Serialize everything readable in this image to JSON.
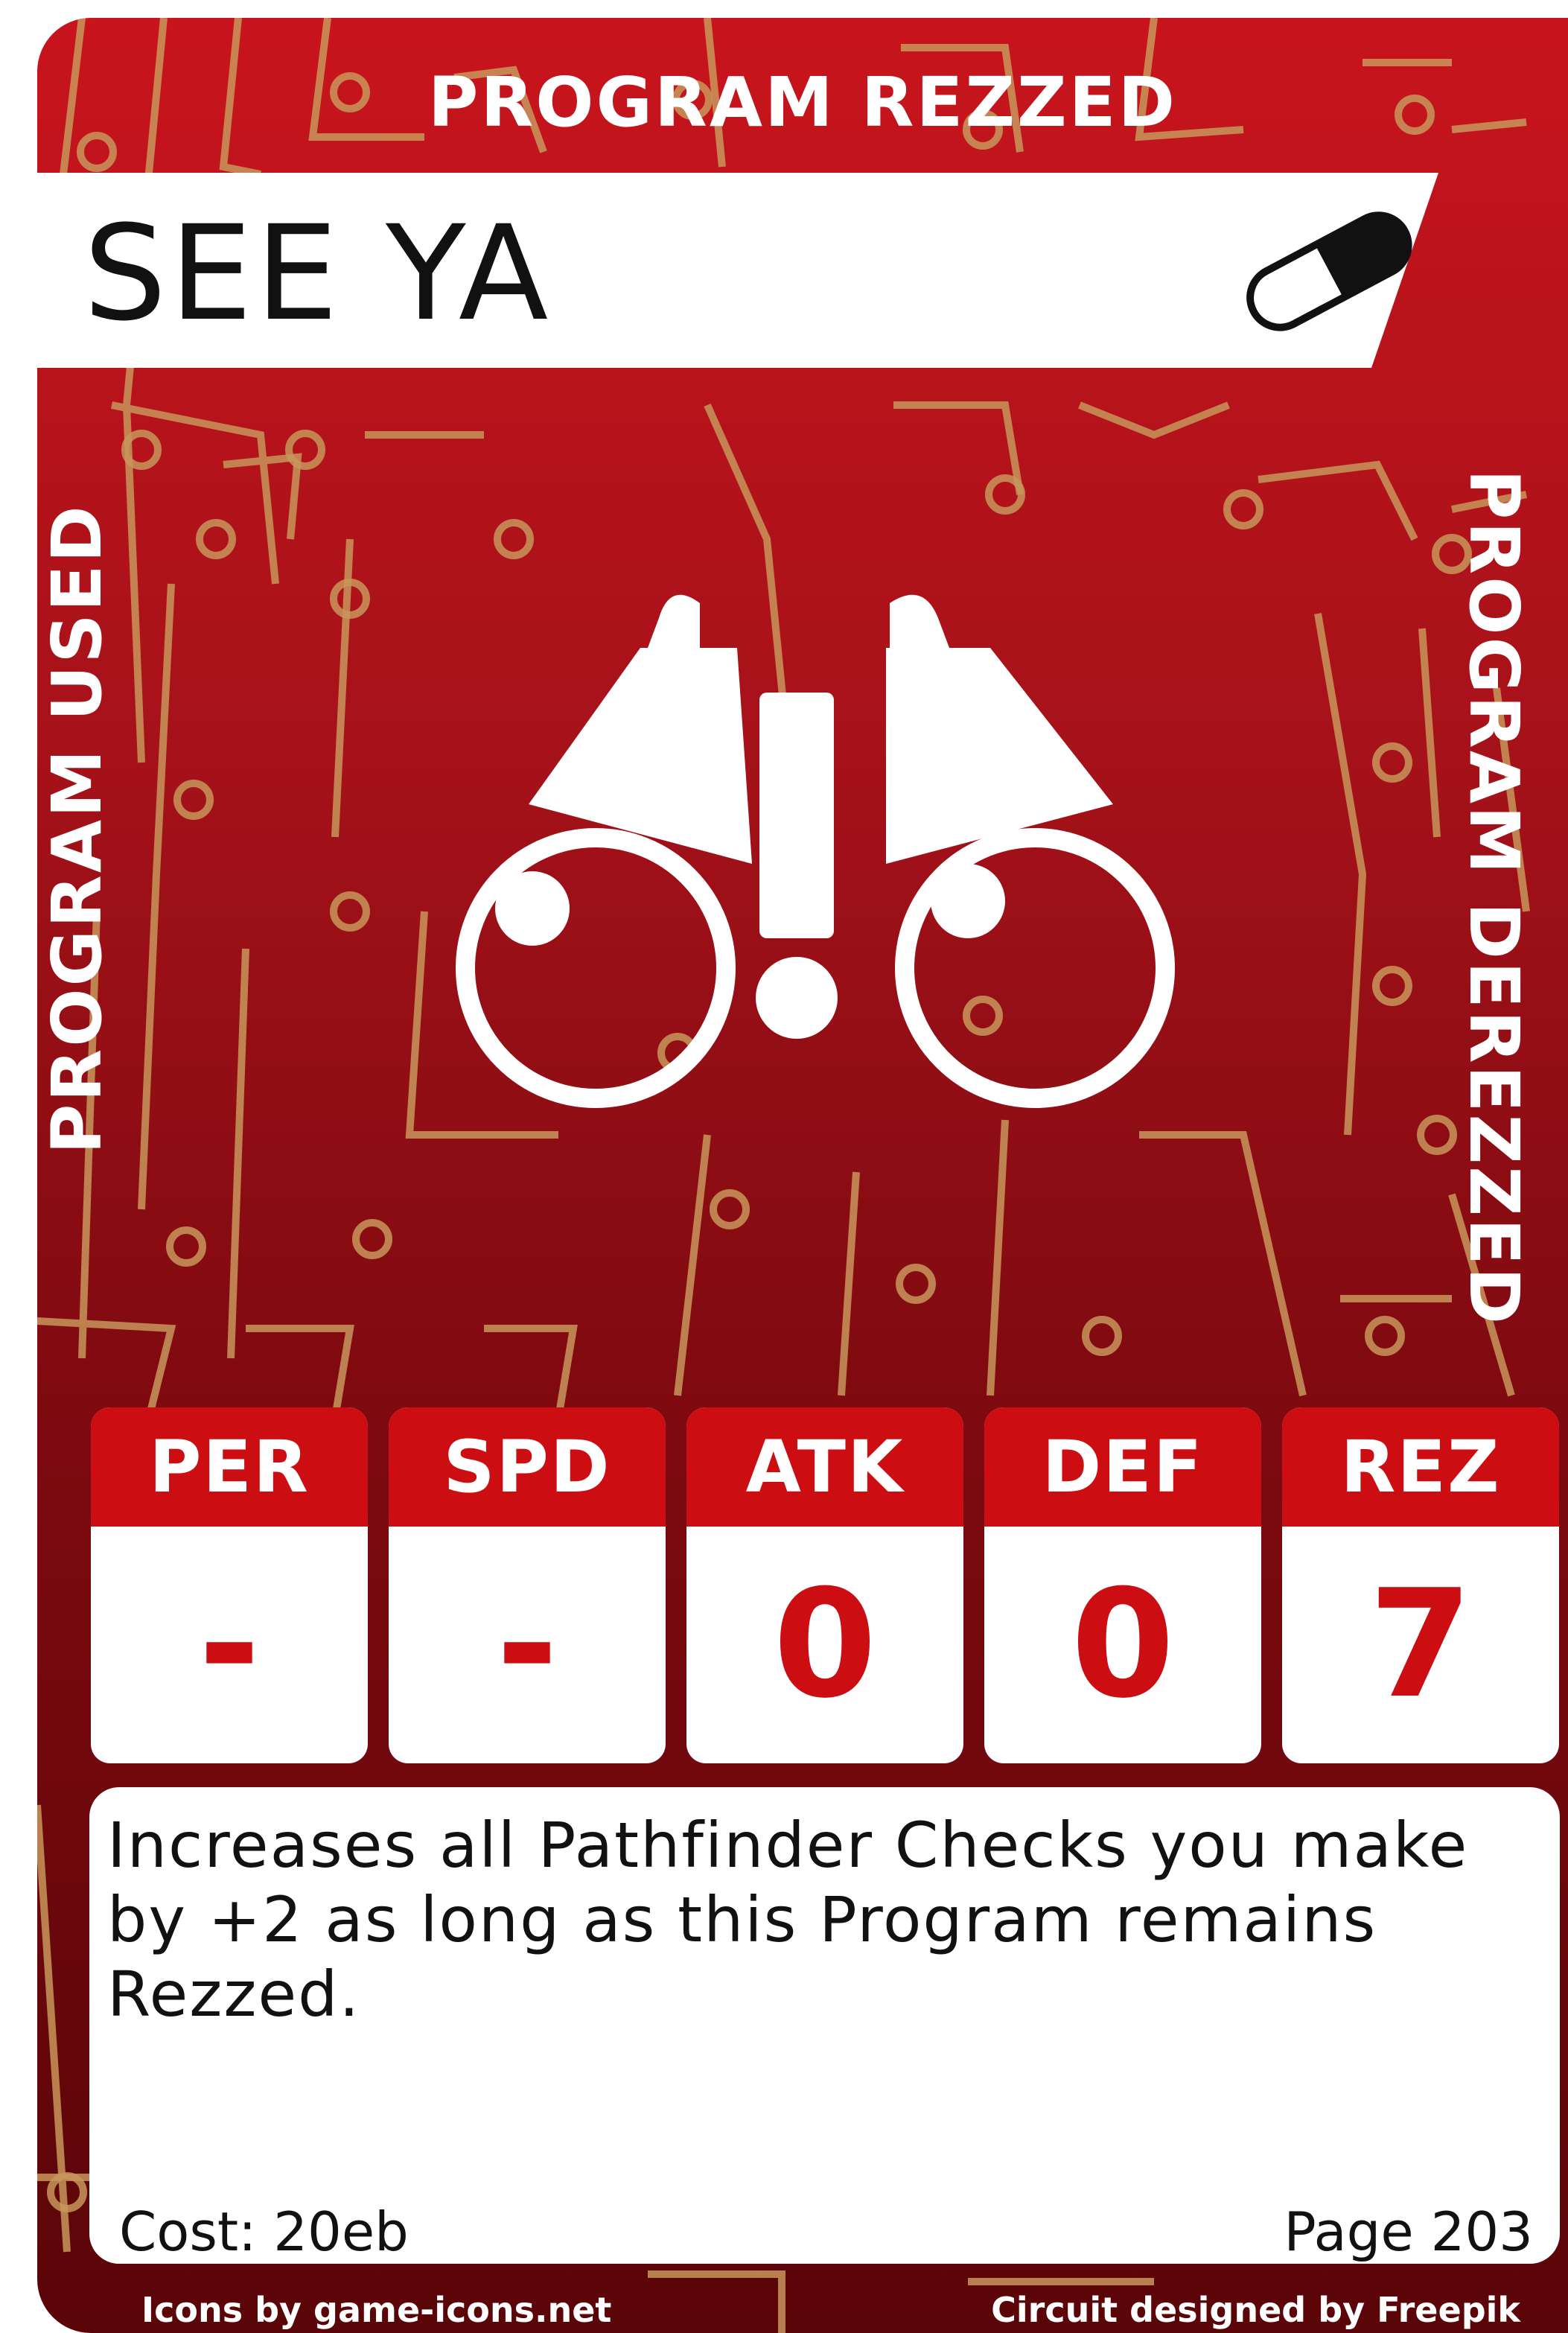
{
  "header": {
    "label": "PROGRAM REZZED"
  },
  "title": {
    "text": "SEE YA",
    "icon": "pill-icon"
  },
  "sides": {
    "left": "PROGRAM USED",
    "right": "PROGRAM DEREZZED"
  },
  "art": {
    "icon": "binoculars-exclamation-icon"
  },
  "stats": [
    {
      "label": "PER",
      "value": "-"
    },
    {
      "label": "SPD",
      "value": "-"
    },
    {
      "label": "ATK",
      "value": "0"
    },
    {
      "label": "DEF",
      "value": "0"
    },
    {
      "label": "REZ",
      "value": "7"
    }
  ],
  "body": {
    "description": "Increases all Pathfinder Checks you make by +2 as long as this Program remains Rezzed.",
    "cost": "Cost: 20eb",
    "page": "Page 203"
  },
  "footer": {
    "left": "Icons by game-icons.net",
    "right": "Circuit designed by Freepik"
  },
  "colors": {
    "card_red": "#c8141c",
    "stat_red": "#cc0d12",
    "circuit": "#c8965a"
  }
}
